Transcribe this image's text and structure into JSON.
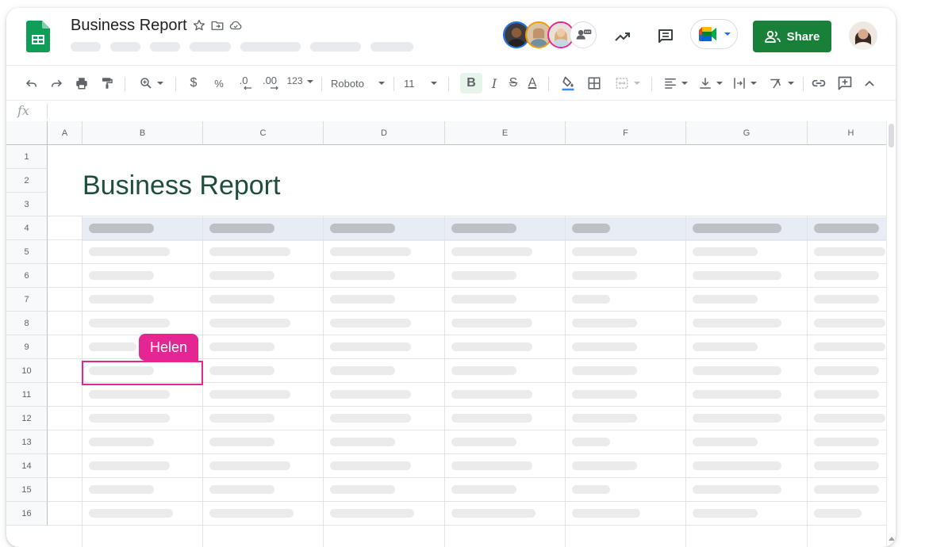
{
  "header": {
    "title": "Business Report",
    "share_label": "Share",
    "icons": {
      "star": "star-icon",
      "move": "move-to-folder-icon",
      "cloud": "cloud-status-icon",
      "trend": "activity-trend-icon",
      "comments": "comments-icon",
      "meet": "google-meet-icon",
      "share": "people-icon"
    },
    "brand_color": "#188038"
  },
  "toolbar": {
    "font": "Roboto",
    "size": "11",
    "number_format": "123",
    "decimal_decrease": ".0",
    "decimal_increase": ".00",
    "currency": "$",
    "percent": "%",
    "bold": "B",
    "italic": "I",
    "strikethrough": "S",
    "text_color": "A"
  },
  "formula_bar": {
    "label": "fx"
  },
  "sheet": {
    "columns": [
      "A",
      "B",
      "C",
      "D",
      "E",
      "F",
      "G",
      "H"
    ],
    "rows": [
      "1",
      "2",
      "3",
      "4",
      "5",
      "6",
      "7",
      "8",
      "9",
      "10",
      "11",
      "12",
      "13",
      "14",
      "15",
      "16"
    ],
    "report_title": "Business Report",
    "header_band_color": "#e8edf5"
  },
  "collaborator": {
    "name": "Helen",
    "color": "#e52592"
  }
}
